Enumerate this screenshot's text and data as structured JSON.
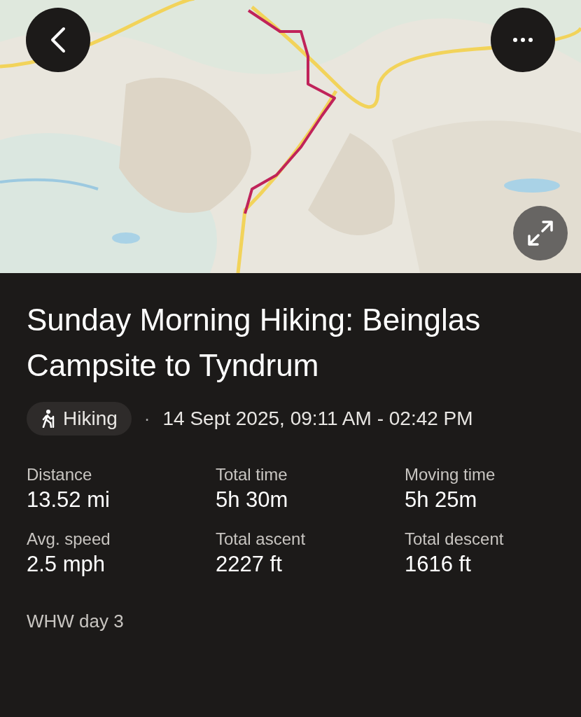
{
  "title": "Sunday Morning Hiking: Beinglas Campsite to Tyndrum",
  "activity": {
    "label": "Hiking"
  },
  "separator": "·",
  "date_range": "14 Sept 2025, 09:11 AM - 02:42 PM",
  "stats": [
    {
      "label": "Distance",
      "value": "13.52 mi"
    },
    {
      "label": "Total time",
      "value": "5h 30m"
    },
    {
      "label": "Moving time",
      "value": "5h 25m"
    },
    {
      "label": "Avg. speed",
      "value": "2.5 mph"
    },
    {
      "label": "Total ascent",
      "value": "2227 ft"
    },
    {
      "label": "Total descent",
      "value": "1616 ft"
    }
  ],
  "note": "WHW day 3"
}
